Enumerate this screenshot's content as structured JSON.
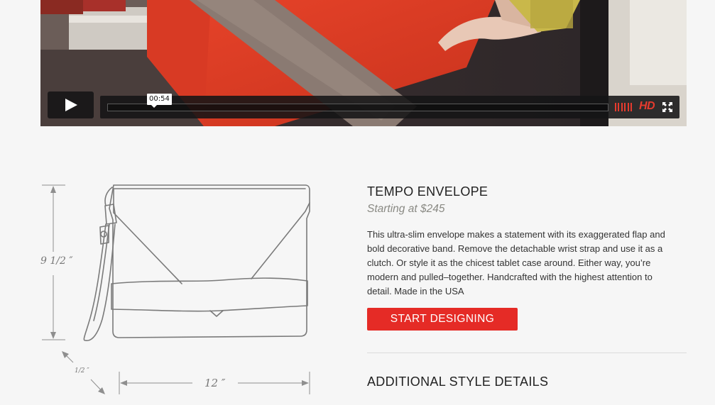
{
  "video": {
    "time": "00:54",
    "progress": 0,
    "play_icon": "play-icon",
    "volume_icon": "volume-bars-icon",
    "hd_label": "HD",
    "fullscreen_icon": "fullscreen-icon",
    "accent_color": "#e63b2e"
  },
  "dimensions": {
    "height": "9 1/2 ″",
    "width": "12 ″",
    "depth": "1/2 ″"
  },
  "product": {
    "name": "TEMPO ENVELOPE",
    "price": "Starting at $245",
    "description": "This ultra-slim envelope makes a statement with its exaggerated flap and bold decorative band. Remove the detachable wrist strap and use it as a clutch. Or style it as the chicest tablet case around. Either way, you’re modern and pulled–together. Handcrafted with the highest attention to detail. Made in the USA",
    "cta_label": "START DESIGNING",
    "cta_color": "#e52b26"
  },
  "sections": {
    "additional_title": "ADDITIONAL STYLE DETAILS"
  }
}
